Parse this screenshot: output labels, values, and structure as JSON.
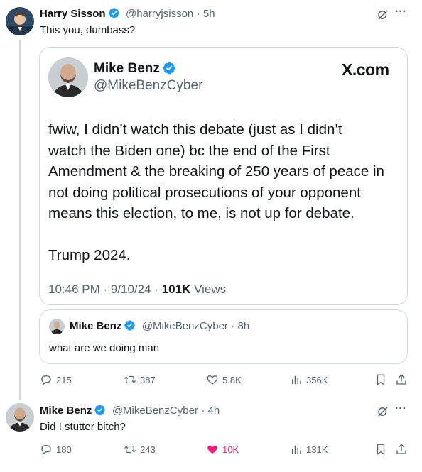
{
  "tweet1": {
    "name": "Harry Sisson",
    "handle": "@harryjsisson",
    "time": "· 5h",
    "text": "This you, dumbass?",
    "screenshot": {
      "name": "Mike Benz",
      "handle": "@MikeBenzCyber",
      "brand": "X.com",
      "text": "fwiw, I didn’t watch this debate (just as I didn’t\nwatch the Biden one) bc the end of the First\nAmendment & the breaking of 250 years of peace in\nnot doing political prosecutions of your opponent\nmeans this election, to me, is not up for debate.\n\nTrump 2024.",
      "time": "10:46 PM",
      "date": "9/10/24",
      "views_count": "101K",
      "views_label": "Views"
    },
    "quote": {
      "name": "Mike Benz",
      "handle": "@MikeBenzCyber",
      "time": "· 8h",
      "text": "what are we doing man"
    },
    "actions": {
      "replies": "215",
      "reposts": "387",
      "likes": "5.8K",
      "views": "356K"
    }
  },
  "tweet2": {
    "name": "Mike Benz",
    "handle": "@MikeBenzCyber",
    "time": "· 4h",
    "text": "Did I stutter bitch?",
    "actions": {
      "replies": "180",
      "reposts": "243",
      "likes": "10K",
      "views": "131K"
    }
  },
  "icons": {
    "verified": "verified-badge-icon",
    "grok": "grok-icon",
    "more": "more-icon",
    "reply": "reply-icon",
    "repost": "repost-icon",
    "like": "heart-icon",
    "views": "views-icon",
    "bookmark": "bookmark-icon",
    "share": "share-icon"
  },
  "colors": {
    "verified": "#1d9bf0",
    "liked": "#f91880",
    "muted": "#536471",
    "border": "#cfd9de"
  }
}
